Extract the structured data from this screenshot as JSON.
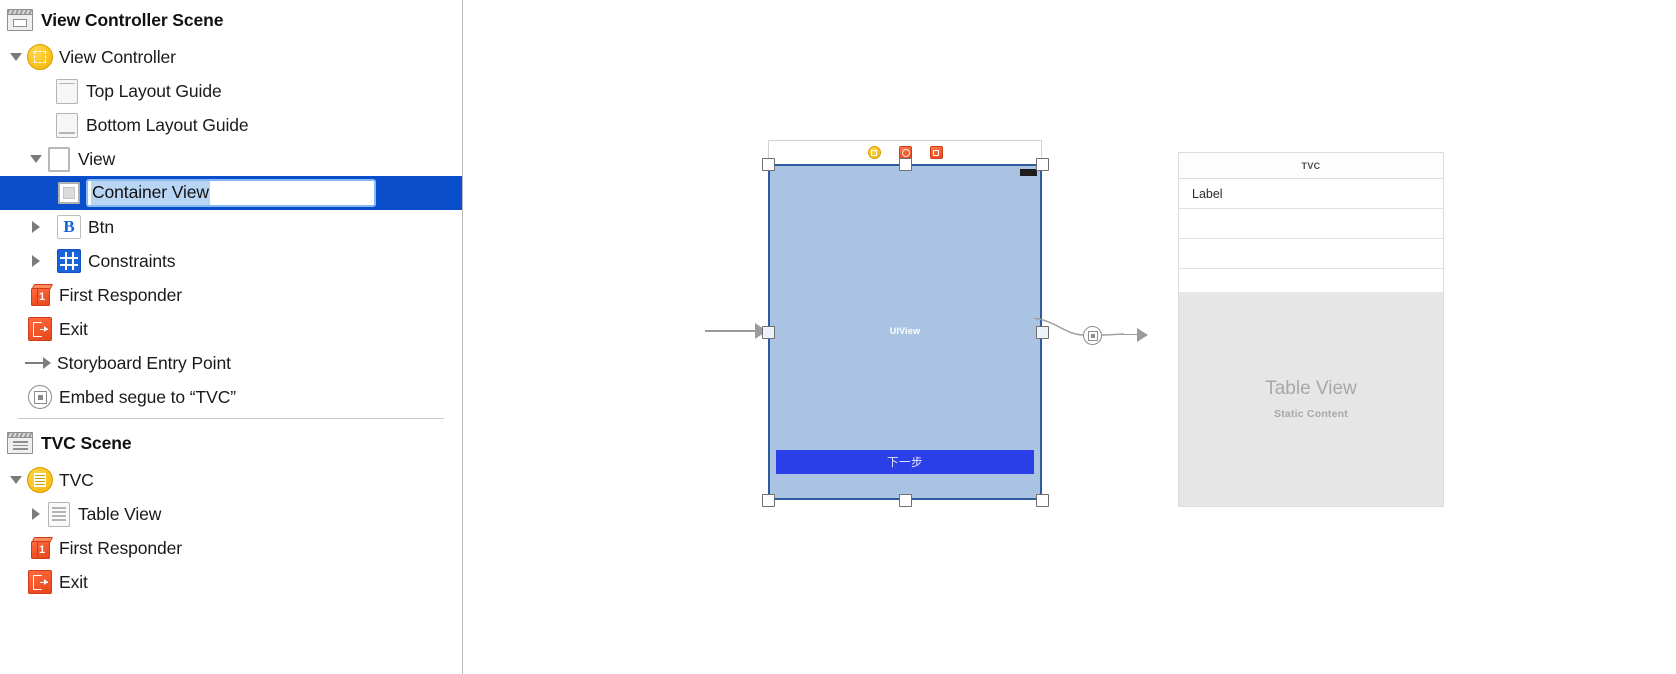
{
  "outline": {
    "scenes": [
      {
        "name": "view-controller-scene",
        "title": "View Controller Scene",
        "icon": "scene-clapper-icon",
        "nodes": [
          {
            "label": "View Controller",
            "icon": "view-controller-icon",
            "disclosure": "expanded",
            "indent": 0
          },
          {
            "label": "Top Layout Guide",
            "icon": "top-layout-guide-icon",
            "disclosure": "none",
            "indent": 1
          },
          {
            "label": "Bottom Layout Guide",
            "icon": "bottom-layout-guide-icon",
            "disclosure": "none",
            "indent": 1
          },
          {
            "label": "View",
            "icon": "view-icon",
            "disclosure": "expanded",
            "indent": 1
          },
          {
            "label": "Container View",
            "icon": "container-view-icon",
            "disclosure": "none",
            "indent": 2,
            "state": "selected-editing"
          },
          {
            "label": "Btn",
            "icon": "button-icon",
            "disclosure": "collapsed",
            "indent": 2
          },
          {
            "label": "Constraints",
            "icon": "constraints-icon",
            "disclosure": "collapsed",
            "indent": 2
          },
          {
            "label": "First Responder",
            "icon": "first-responder-icon",
            "disclosure": "none",
            "indent": 0
          },
          {
            "label": "Exit",
            "icon": "exit-icon",
            "disclosure": "none",
            "indent": 0
          },
          {
            "label": "Storyboard Entry Point",
            "icon": "entry-point-arrow-icon",
            "disclosure": "none",
            "indent": 0
          },
          {
            "label": "Embed segue to “TVC”",
            "icon": "segue-icon",
            "disclosure": "none",
            "indent": 0
          }
        ]
      },
      {
        "name": "tvc-scene",
        "title": "TVC Scene",
        "icon": "scene-clapper-icon",
        "nodes": [
          {
            "label": "TVC",
            "icon": "table-view-controller-icon",
            "disclosure": "expanded",
            "indent": 0
          },
          {
            "label": "Table View",
            "icon": "table-view-icon",
            "disclosure": "collapsed",
            "indent": 1
          },
          {
            "label": "First Responder",
            "icon": "first-responder-icon",
            "disclosure": "none",
            "indent": 0
          },
          {
            "label": "Exit",
            "icon": "exit-icon",
            "disclosure": "none",
            "indent": 0
          }
        ]
      }
    ],
    "editing_field": {
      "value": "Container View",
      "selection_highlighted": true
    }
  },
  "canvas": {
    "view_controller_scene": {
      "dock": {
        "view_controller_icon": "view-controller-dock-icon",
        "first_responder_icon": "first-responder-dock-icon",
        "exit_icon": "exit-dock-icon"
      },
      "root_view_label": "UIView",
      "button": {
        "label": "下一步"
      },
      "selected": true,
      "handles": [
        "top-left",
        "top-center",
        "top-right",
        "mid-left",
        "mid-right",
        "bottom-left",
        "bottom-center",
        "bottom-right"
      ]
    },
    "segue": {
      "badge_icon": "embed-segue-badge-icon",
      "arrow_icon": "segue-arrow-icon"
    },
    "tvc_scene": {
      "nav_title": "TVC",
      "cells": [
        {
          "label": "Label"
        },
        {
          "label": ""
        },
        {
          "label": ""
        }
      ],
      "placeholder_title": "Table View",
      "placeholder_subtitle": "Static Content"
    },
    "entry_point_arrow_icon": "storyboard-entry-arrow-icon"
  },
  "colors": {
    "selection_blue": "#0a4ecc",
    "view_fill": "#aac3e2",
    "view_border": "#2f5c9e",
    "button_blue": "#2b3fe8",
    "placeholder_gray": "#e6e6e6",
    "scene_icon_yellow": "#f5b300",
    "responder_orange": "#e8471c"
  }
}
